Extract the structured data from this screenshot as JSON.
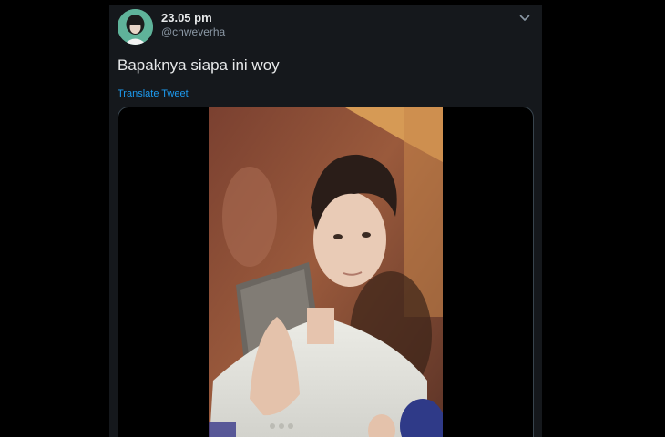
{
  "tweet": {
    "time": "23.05 pm",
    "handle": "@chweverha",
    "text": "Bapaknya siapa ini woy",
    "translate_label": "Translate Tweet"
  },
  "icons": {
    "avatar": "avatar-image",
    "more": "chevron-down-icon"
  },
  "colors": {
    "background": "#000000",
    "card": "#15181c",
    "primary_text": "#e7e9ea",
    "secondary_text": "#8b98a5",
    "link": "#1d9bf0"
  }
}
